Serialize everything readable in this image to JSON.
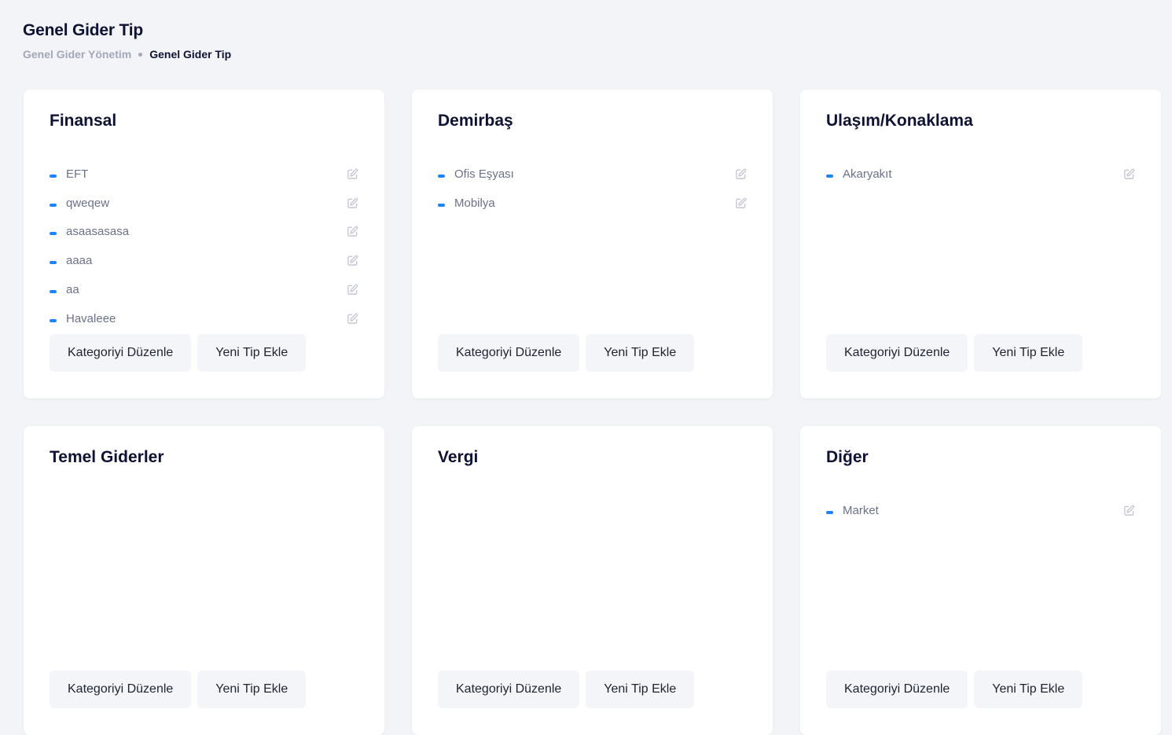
{
  "page": {
    "title": "Genel Gider Tip",
    "breadcrumb": {
      "parent": "Genel Gider Yönetim",
      "current": "Genel Gider Tip"
    }
  },
  "accent_color": "#1b84ff",
  "buttons": {
    "edit_category": "Kategoriyi Düzenle",
    "add_type": "Yeni Tip Ekle"
  },
  "categories": [
    {
      "title": "Finansal",
      "items": [
        "EFT",
        "qweqew",
        "asaasasasa",
        "aaaa",
        "aa",
        "Havaleee"
      ]
    },
    {
      "title": "Demirbaş",
      "items": [
        "Ofis Eşyası",
        "Mobilya"
      ]
    },
    {
      "title": "Ulaşım/Konaklama",
      "items": [
        "Akaryakıt"
      ]
    },
    {
      "title": "Temel Giderler",
      "items": []
    },
    {
      "title": "Vergi",
      "items": []
    },
    {
      "title": "Diğer",
      "items": [
        "Market"
      ]
    }
  ]
}
